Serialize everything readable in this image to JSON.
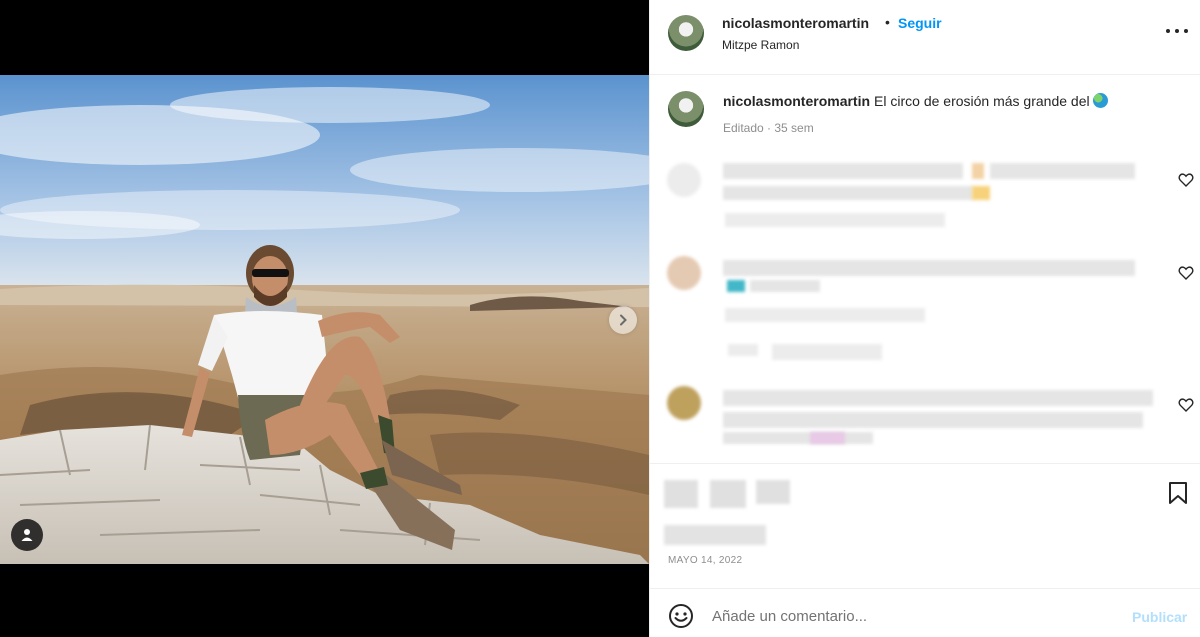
{
  "post": {
    "username": "nicolasmonteromartin",
    "separator": "•",
    "follow_label": "Seguir",
    "location": "Mitzpe Ramon",
    "caption_text": "El circo de erosión más grande del",
    "caption_emoji": "globe-emoji",
    "meta": "Editado · 35 sem",
    "date": "MAYO 14, 2022"
  },
  "comment_box": {
    "placeholder": "Añade un comentario...",
    "publish_label": "Publicar"
  },
  "icons": {
    "more": "more-options-icon",
    "next": "chevron-right-icon",
    "tags": "user-tag-icon",
    "like": "heart-icon",
    "save": "bookmark-icon",
    "emoji": "smiley-icon"
  },
  "colors": {
    "accent": "#0095f6",
    "publish_disabled": "#b2dffc",
    "muted_text": "#8e8e8e"
  }
}
